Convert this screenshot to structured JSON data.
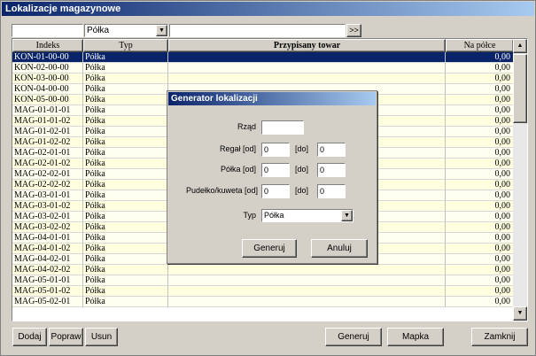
{
  "window": {
    "title": "Lokalizacje magazynowe"
  },
  "filter": {
    "index_value": "",
    "type_value": "Półka",
    "text_value": "",
    "go_label": ">>"
  },
  "grid": {
    "columns": [
      "Indeks",
      "Typ",
      "Przypisany towar",
      "Na półce"
    ],
    "rows": [
      [
        "KON-01-00-00",
        "Półka",
        "",
        "0,00"
      ],
      [
        "KON-02-00-00",
        "Półka",
        "",
        "0,00"
      ],
      [
        "KON-03-00-00",
        "Półka",
        "",
        "0,00"
      ],
      [
        "KON-04-00-00",
        "Półka",
        "",
        "0,00"
      ],
      [
        "KON-05-00-00",
        "Półka",
        "",
        "0,00"
      ],
      [
        "MAG-01-01-01",
        "Półka",
        "",
        "0,00"
      ],
      [
        "MAG-01-01-02",
        "Półka",
        "",
        "0,00"
      ],
      [
        "MAG-01-02-01",
        "Półka",
        "",
        "0,00"
      ],
      [
        "MAG-01-02-02",
        "Półka",
        "",
        "0,00"
      ],
      [
        "MAG-02-01-01",
        "Półka",
        "",
        "0,00"
      ],
      [
        "MAG-02-01-02",
        "Półka",
        "",
        "0,00"
      ],
      [
        "MAG-02-02-01",
        "Półka",
        "",
        "0,00"
      ],
      [
        "MAG-02-02-02",
        "Półka",
        "",
        "0,00"
      ],
      [
        "MAG-03-01-01",
        "Półka",
        "",
        "0,00"
      ],
      [
        "MAG-03-01-02",
        "Półka",
        "",
        "0,00"
      ],
      [
        "MAG-03-02-01",
        "Półka",
        "",
        "0,00"
      ],
      [
        "MAG-03-02-02",
        "Półka",
        "",
        "0,00"
      ],
      [
        "MAG-04-01-01",
        "Półka",
        "",
        "0,00"
      ],
      [
        "MAG-04-01-02",
        "Półka",
        "",
        "0,00"
      ],
      [
        "MAG-04-02-01",
        "Półka",
        "",
        "0,00"
      ],
      [
        "MAG-04-02-02",
        "Półka",
        "",
        "0,00"
      ],
      [
        "MAG-05-01-01",
        "Półka",
        "",
        "0,00"
      ],
      [
        "MAG-05-01-02",
        "Półka",
        "",
        "0,00"
      ],
      [
        "MAG-05-02-01",
        "Półka",
        "",
        "0,00"
      ]
    ]
  },
  "buttons": {
    "add": "Dodaj",
    "edit": "Popraw",
    "delete": "Usun",
    "generate": "Generuj",
    "map": "Mapka",
    "close": "Zamknij"
  },
  "dialog": {
    "title": "Generator lokalizacji",
    "row_label": "Rząd",
    "row_value": "",
    "rack_label": "Regał [od]",
    "rack_from": "0",
    "rack_to": "0",
    "shelf_label": "Półka [od]",
    "shelf_from": "0",
    "shelf_to": "0",
    "box_label": "Pudełko/kuweta [od]",
    "box_from": "0",
    "box_to": "0",
    "to_label": "[do]",
    "type_label": "Typ",
    "type_value": "Półka",
    "generate_label": "Generuj",
    "cancel_label": "Anuluj"
  }
}
